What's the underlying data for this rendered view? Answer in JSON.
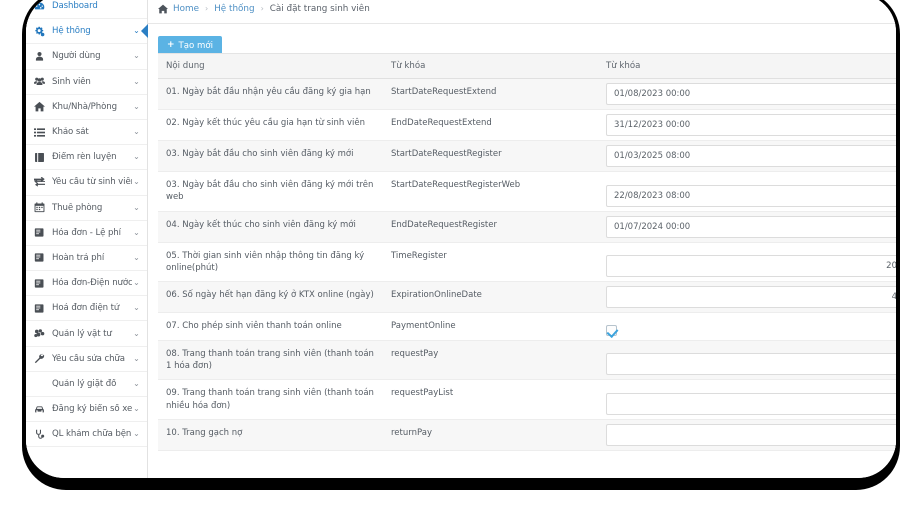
{
  "sidebar": {
    "items": [
      {
        "label": "Dashboard",
        "icon": "dashboard-icon",
        "caret": false,
        "accent": true,
        "active": false
      },
      {
        "label": "Hệ thống",
        "icon": "gears-icon",
        "caret": true,
        "accent": true,
        "active": true
      },
      {
        "label": "Người dùng",
        "icon": "user-icon",
        "caret": true,
        "accent": false,
        "active": false
      },
      {
        "label": "Sinh viên",
        "icon": "users-icon",
        "caret": true,
        "accent": false,
        "active": false
      },
      {
        "label": "Khu/Nhà/Phòng",
        "icon": "home-icon",
        "caret": true,
        "accent": false,
        "active": false
      },
      {
        "label": "Khảo sát",
        "icon": "list-icon",
        "caret": true,
        "accent": false,
        "active": false
      },
      {
        "label": "Điểm rèn luyện",
        "icon": "book-icon",
        "caret": true,
        "accent": false,
        "active": false
      },
      {
        "label": "Yêu cầu từ sinh viên",
        "icon": "exchange-icon",
        "caret": true,
        "accent": false,
        "active": false
      },
      {
        "label": "Thuê phòng",
        "icon": "calendar-icon",
        "caret": true,
        "accent": false,
        "active": false
      },
      {
        "label": "Hóa đơn - Lệ phí",
        "icon": "invoice-icon",
        "caret": true,
        "accent": false,
        "active": false
      },
      {
        "label": "Hoàn trả phí",
        "icon": "invoice-icon",
        "caret": true,
        "accent": false,
        "active": false
      },
      {
        "label": "Hóa đơn-Điện nước",
        "icon": "invoice-icon",
        "caret": true,
        "accent": false,
        "active": false
      },
      {
        "label": "Hoá đơn điện tử",
        "icon": "invoice-icon",
        "caret": true,
        "accent": false,
        "active": false
      },
      {
        "label": "Quản lý vật tư",
        "icon": "boxes-icon",
        "caret": true,
        "accent": false,
        "active": false
      },
      {
        "label": "Yêu cầu sửa chữa",
        "icon": "wrench-icon",
        "caret": true,
        "accent": false,
        "active": false
      },
      {
        "label": "Quản lý giặt đồ",
        "icon": "none",
        "caret": true,
        "accent": false,
        "active": false
      },
      {
        "label": "Đăng ký biển số xe",
        "icon": "car-icon",
        "caret": true,
        "accent": false,
        "active": false
      },
      {
        "label": "QL khám chữa bệnh",
        "icon": "stethoscope-icon",
        "caret": true,
        "accent": false,
        "active": false
      }
    ]
  },
  "breadcrumb": {
    "home_label": "Home",
    "section_label": "Hệ thống",
    "current_label": "Cài đặt trang sinh viên",
    "separator": "›"
  },
  "toolbar": {
    "create_label": "Tạo mới",
    "create_plus": "+"
  },
  "table": {
    "headers": [
      "Nội dung",
      "Từ khóa",
      "Từ khóa"
    ],
    "rows": [
      {
        "content": "01. Ngày bắt đầu nhận yêu cầu đăng ký gia hạn",
        "keyword": "StartDateRequestExtend",
        "value": "01/08/2023 00:00",
        "type": "text"
      },
      {
        "content": "02. Ngày kết thúc yêu cầu gia hạn từ sinh viên",
        "keyword": "EndDateRequestExtend",
        "value": "31/12/2023 00:00",
        "type": "text"
      },
      {
        "content": "03. Ngày bắt đầu cho sinh viên đăng ký mới",
        "keyword": "StartDateRequestRegister",
        "value": "01/03/2025 08:00",
        "type": "text"
      },
      {
        "content": "03. Ngày bắt đầu cho sinh viên đăng ký mới trên web",
        "keyword": "StartDateRequestRegisterWeb",
        "value": "22/08/2023 08:00",
        "type": "text"
      },
      {
        "content": "04. Ngày kết thúc cho sinh viên đăng ký mới",
        "keyword": "EndDateRequestRegister",
        "value": "01/07/2024 00:00",
        "type": "text"
      },
      {
        "content": "05. Thời gian sinh viên nhập thông tin đăng ký online(phút)",
        "keyword": "TimeRegister",
        "value": "20",
        "type": "number"
      },
      {
        "content": "06. Số ngày hết hạn đăng ký ở KTX online (ngày)",
        "keyword": "ExpirationOnlineDate",
        "value": "4",
        "type": "number"
      },
      {
        "content": "07. Cho phép sinh viên thanh toán online",
        "keyword": "PaymentOnline",
        "value": "checked",
        "type": "checkbox"
      },
      {
        "content": "08. Trang thanh toán trang sinh viên (thanh toán 1 hóa đơn)",
        "keyword": "requestPay",
        "value": "",
        "type": "text"
      },
      {
        "content": "09. Trang thanh toán trang sinh viên (thanh toán nhiều hóa đơn)",
        "keyword": "requestPayList",
        "value": "",
        "type": "text"
      },
      {
        "content": "10. Trang gạch nợ",
        "keyword": "returnPay",
        "value": "",
        "type": "text"
      }
    ]
  },
  "colors": {
    "accent": "#2b7fc4",
    "button": "#5bb3e4",
    "header_bg": "#f5f5f5",
    "checkbox_check": "#3ba3dd"
  }
}
